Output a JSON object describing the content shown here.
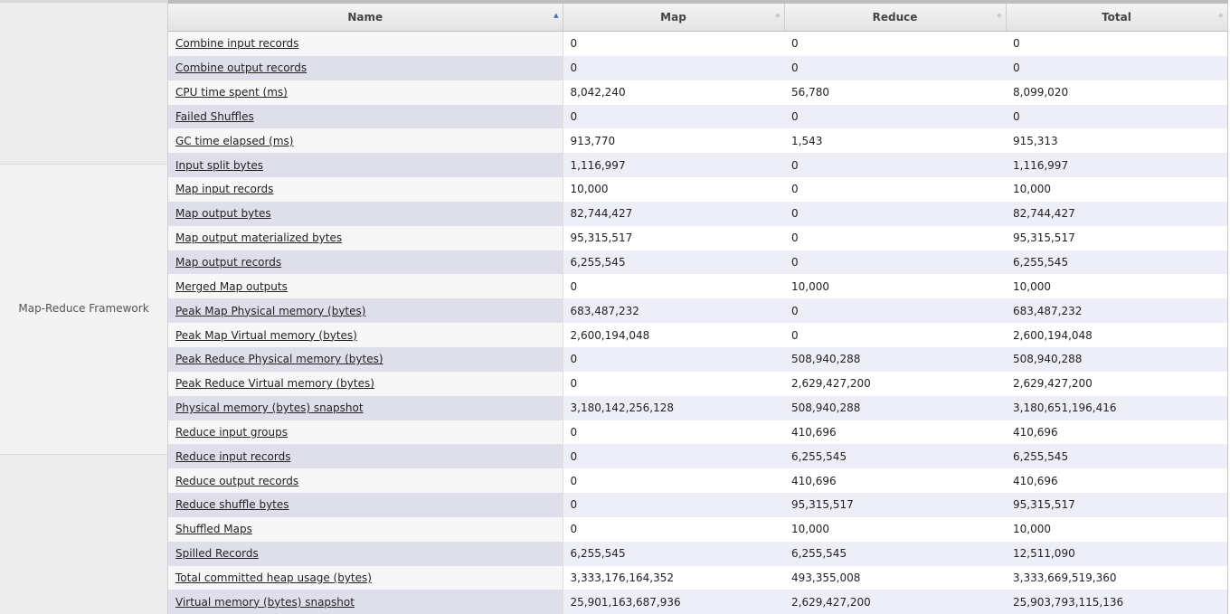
{
  "group": {
    "label": "Map-Reduce Framework"
  },
  "columns": {
    "name": "Name",
    "map": "Map",
    "reduce": "Reduce",
    "total": "Total"
  },
  "sort_icons": {
    "active": "sort-ascending-icon",
    "inactive": "sort-neutral-icon",
    "active_color": "#4b6cb7"
  },
  "rows": [
    {
      "name": "Combine input records",
      "map": "0",
      "reduce": "0",
      "total": "0"
    },
    {
      "name": "Combine output records",
      "map": "0",
      "reduce": "0",
      "total": "0"
    },
    {
      "name": "CPU time spent (ms)",
      "map": "8,042,240",
      "reduce": "56,780",
      "total": "8,099,020"
    },
    {
      "name": "Failed Shuffles",
      "map": "0",
      "reduce": "0",
      "total": "0"
    },
    {
      "name": "GC time elapsed (ms)",
      "map": "913,770",
      "reduce": "1,543",
      "total": "915,313"
    },
    {
      "name": "Input split bytes",
      "map": "1,116,997",
      "reduce": "0",
      "total": "1,116,997"
    },
    {
      "name": "Map input records",
      "map": "10,000",
      "reduce": "0",
      "total": "10,000"
    },
    {
      "name": "Map output bytes",
      "map": "82,744,427",
      "reduce": "0",
      "total": "82,744,427"
    },
    {
      "name": "Map output materialized bytes",
      "map": "95,315,517",
      "reduce": "0",
      "total": "95,315,517"
    },
    {
      "name": "Map output records",
      "map": "6,255,545",
      "reduce": "0",
      "total": "6,255,545"
    },
    {
      "name": "Merged Map outputs",
      "map": "0",
      "reduce": "10,000",
      "total": "10,000"
    },
    {
      "name": "Peak Map Physical memory (bytes)",
      "map": "683,487,232",
      "reduce": "0",
      "total": "683,487,232"
    },
    {
      "name": "Peak Map Virtual memory (bytes)",
      "map": "2,600,194,048",
      "reduce": "0",
      "total": "2,600,194,048"
    },
    {
      "name": "Peak Reduce Physical memory (bytes)",
      "map": "0",
      "reduce": "508,940,288",
      "total": "508,940,288"
    },
    {
      "name": "Peak Reduce Virtual memory (bytes)",
      "map": "0",
      "reduce": "2,629,427,200",
      "total": "2,629,427,200"
    },
    {
      "name": "Physical memory (bytes) snapshot",
      "map": "3,180,142,256,128",
      "reduce": "508,940,288",
      "total": "3,180,651,196,416"
    },
    {
      "name": "Reduce input groups",
      "map": "0",
      "reduce": "410,696",
      "total": "410,696"
    },
    {
      "name": "Reduce input records",
      "map": "0",
      "reduce": "6,255,545",
      "total": "6,255,545"
    },
    {
      "name": "Reduce output records",
      "map": "0",
      "reduce": "410,696",
      "total": "410,696"
    },
    {
      "name": "Reduce shuffle bytes",
      "map": "0",
      "reduce": "95,315,517",
      "total": "95,315,517"
    },
    {
      "name": "Shuffled Maps",
      "map": "0",
      "reduce": "10,000",
      "total": "10,000"
    },
    {
      "name": "Spilled Records",
      "map": "6,255,545",
      "reduce": "6,255,545",
      "total": "12,511,090"
    },
    {
      "name": "Total committed heap usage (bytes)",
      "map": "3,333,176,164,352",
      "reduce": "493,355,008",
      "total": "3,333,669,519,360"
    },
    {
      "name": "Virtual memory (bytes) snapshot",
      "map": "25,901,163,687,936",
      "reduce": "2,629,427,200",
      "total": "25,903,793,115,136"
    }
  ]
}
